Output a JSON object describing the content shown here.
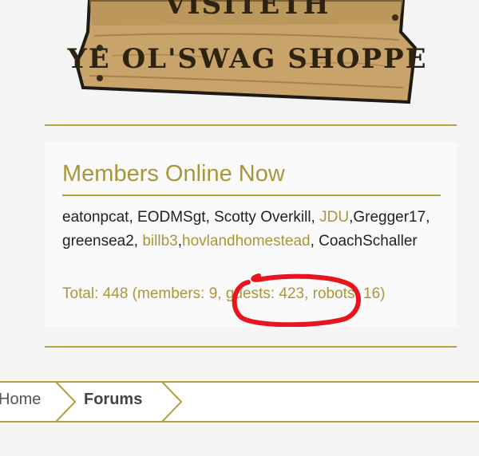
{
  "banner": {
    "line1": "VISITETH",
    "line2": "YE OL'SWAG SHOPPE"
  },
  "members_online": {
    "title": "Members Online Now",
    "members": [
      {
        "name": "eatonpcat",
        "link": false,
        "sep": ", "
      },
      {
        "name": "EODMSgt",
        "link": false,
        "sep": ", "
      },
      {
        "name": "Scotty Overkill",
        "link": false,
        "sep": ", "
      },
      {
        "name": "JDU",
        "link": true,
        "sep": ","
      },
      {
        "name": "Gregger17",
        "link": false,
        "sep": ", "
      },
      {
        "name": "greensea2",
        "link": false,
        "sep": ", "
      },
      {
        "name": "billb3",
        "link": true,
        "sep": ","
      },
      {
        "name": "hovlandhomestead",
        "link": true,
        "sep": ", "
      },
      {
        "name": "CoachSchaller",
        "link": false,
        "sep": ""
      }
    ],
    "totals_text": "Total: 448 (members: 9, guests: 423, robots: 16)"
  },
  "breadcrumb": {
    "items": [
      "Home",
      "Forums"
    ]
  },
  "colors": {
    "accent": "#a8973a",
    "annotation": "#e8141e",
    "wood": "#c9a46a"
  }
}
